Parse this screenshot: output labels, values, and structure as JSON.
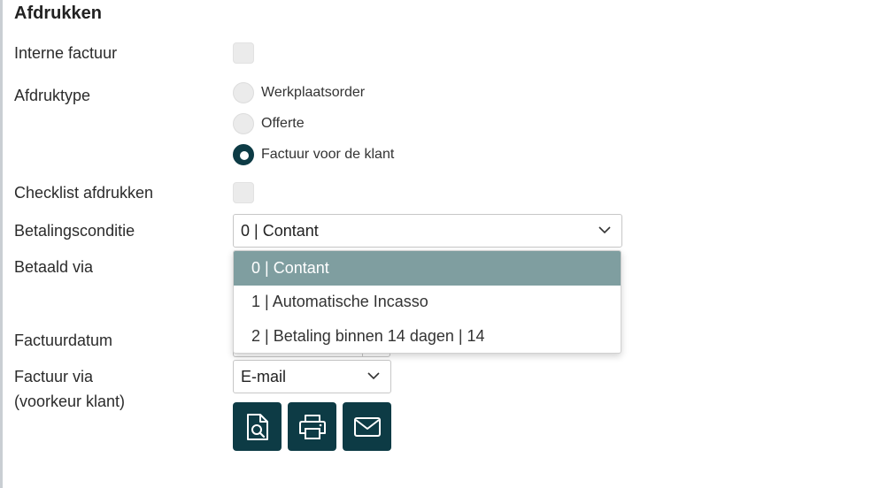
{
  "section": {
    "title": "Afdrukken"
  },
  "fields": {
    "internal_invoice": {
      "label": "Interne factuur",
      "checked": false
    },
    "print_type": {
      "label": "Afdruktype",
      "options": [
        {
          "label": "Werkplaatsorder",
          "checked": false
        },
        {
          "label": "Offerte",
          "checked": false
        },
        {
          "label": "Factuur voor de klant",
          "checked": true
        }
      ]
    },
    "print_checklist": {
      "label": "Checklist afdrukken",
      "checked": false
    },
    "payment_condition": {
      "label": "Betalingsconditie",
      "value": "0 | Contant",
      "options": [
        {
          "label": "0 | Contant",
          "selected": true
        },
        {
          "label": "1 | Automatische Incasso",
          "selected": false
        },
        {
          "label": "2 | Betaling binnen 14 dagen | 14",
          "selected": false
        }
      ]
    },
    "paid_via": {
      "label": "Betaald via"
    },
    "invoice_date": {
      "label": "Factuurdatum"
    },
    "invoice_via": {
      "label_line1": "Factuur via",
      "label_line2": "(voorkeur klant)",
      "value": "E-mail"
    }
  },
  "actions": {
    "preview": {
      "icon": "document-search-icon"
    },
    "print": {
      "icon": "printer-icon"
    },
    "email": {
      "icon": "envelope-icon"
    }
  },
  "colors": {
    "primary": "#0d3b45",
    "dropdown_selected": "#7f9ea0",
    "control_bg": "#ebebeb"
  }
}
